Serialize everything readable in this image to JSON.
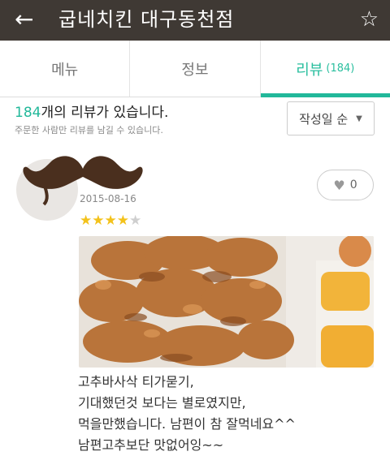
{
  "header": {
    "back_icon": "arrow-left-icon",
    "title": "굽네치킨 대구동천점",
    "favorite_icon": "star-outline-icon"
  },
  "tabs": [
    {
      "label": "메뉴",
      "active": false
    },
    {
      "label": "정보",
      "active": false
    },
    {
      "label": "리뷰",
      "count": "(184)",
      "active": true
    }
  ],
  "summary": {
    "count": "184",
    "text": "개의 리뷰가 있습니다.",
    "note": "주문한 사람만 리뷰를 남길 수 있습니다."
  },
  "sort": {
    "label": "작성일 순",
    "icon": "caret-down-icon"
  },
  "review": {
    "date": "2015-08-16",
    "rating": 4,
    "rating_max": 5,
    "likes": "0",
    "lines": [
      "고추바사삭 티가묻기,",
      "기대했던것 보다는 별로였지만,",
      "먹을만했습니다. 남편이 참 잘먹네요^^",
      "남편고추보단 맛없어잉~~"
    ]
  },
  "colors": {
    "accent": "#22b89a",
    "header_bg": "#3f3934",
    "star": "#f3c21b"
  }
}
